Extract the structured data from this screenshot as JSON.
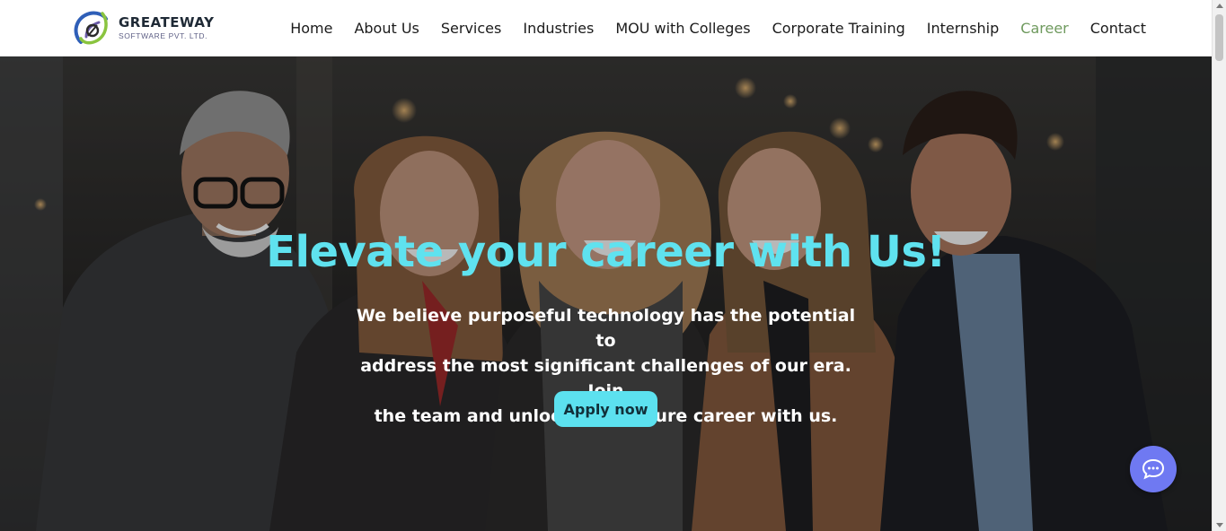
{
  "brand": {
    "name": "GREATEWAY",
    "subtitle": "SOFTWARE PVT. LTD.",
    "colors": {
      "blue": "#2f5fb8",
      "green": "#8ac43f",
      "purple": "#6b5ba8"
    }
  },
  "nav": {
    "items": [
      {
        "label": "Home",
        "active": false
      },
      {
        "label": "About Us",
        "active": false
      },
      {
        "label": "Services",
        "active": false
      },
      {
        "label": "Industries",
        "active": false
      },
      {
        "label": "MOU with Colleges",
        "active": false
      },
      {
        "label": "Corporate Training",
        "active": false
      },
      {
        "label": "Internship",
        "active": false
      },
      {
        "label": "Career",
        "active": true
      },
      {
        "label": "Contact",
        "active": false
      }
    ],
    "active_color": "#6f9a5e"
  },
  "hero": {
    "title": "Elevate your career with Us!",
    "lines": [
      "We believe purposeful technology has the potential to",
      "address the most significant challenges of our era. Join",
      "the team and unlock your future career with us."
    ],
    "button_label": "Apply now",
    "image_description_icon": "team-photo",
    "accent_color": "#5fe2ef"
  },
  "chat": {
    "icon": "chat-bubble-icon",
    "color": "#6f79f2"
  }
}
